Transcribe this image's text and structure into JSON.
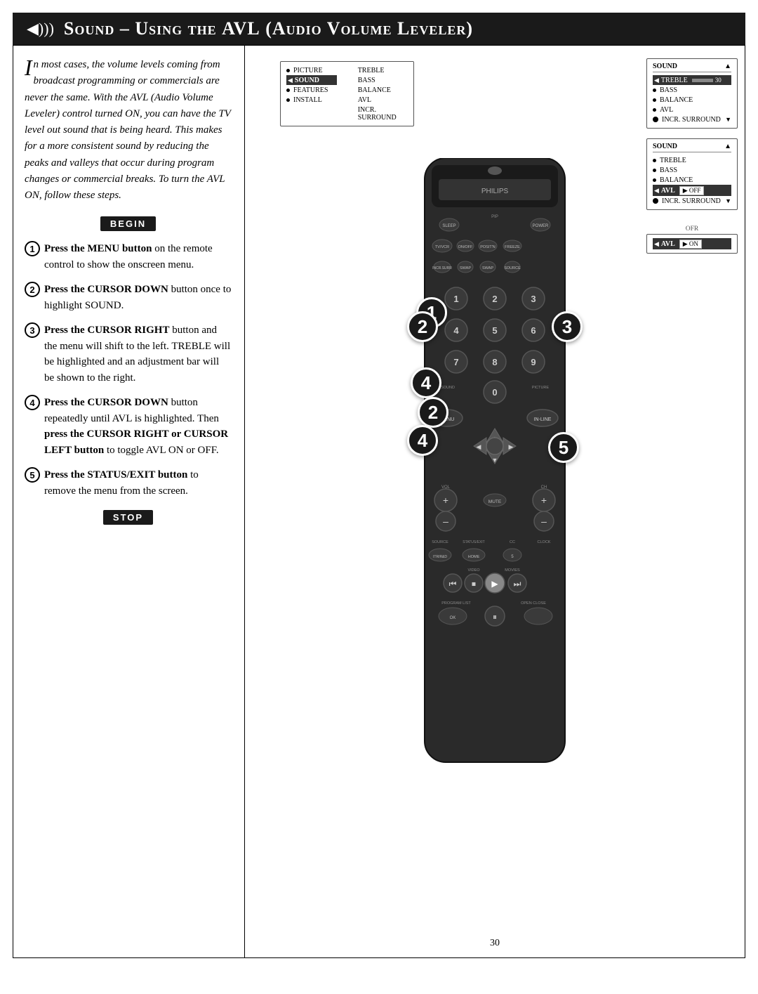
{
  "header": {
    "title": "Sound – Using the AVL (Audio Volume Leveler)",
    "icon": "◀)))"
  },
  "intro": {
    "text": "n most cases, the volume levels coming from broadcast programming or commercials are never the same.  With the AVL (Audio Volume Leveler) control turned ON, you can have the TV level out sound that is being heard.  This makes for a more consistent sound by reducing the peaks and valleys that occur during program changes or commercial breaks.  To turn the AVL ON, follow these steps."
  },
  "begin_label": "BEGIN",
  "stop_label": "STOP",
  "steps": [
    {
      "num": "1",
      "text_bold": "Press the MENU button",
      "text_rest": " on the remote control to show the onscreen menu."
    },
    {
      "num": "2",
      "text_bold": "Press the CURSOR DOWN",
      "text_rest": " button once to highlight SOUND."
    },
    {
      "num": "3",
      "text_bold": "Press the CURSOR RIGHT",
      "text_rest": " button and the menu will shift to the left. TREBLE will be highlighted and an adjustment bar will be shown to the right."
    },
    {
      "num": "4",
      "text_bold": "Press the CURSOR DOWN",
      "text_rest": " button repeatedly until AVL is highlighted.  Then press the CURSOR RIGHT or CURSOR LEFT button to toggle AVL ON or OFF."
    },
    {
      "num": "5",
      "text_bold": "Press the STATUS/EXIT but-",
      "text_rest": "ton to remove the menu from the screen."
    }
  ],
  "menu_main": {
    "items": [
      {
        "label": "PICTURE",
        "right": "TREBLE",
        "bullet": true,
        "selected": false
      },
      {
        "label": "SOUND",
        "right": "BASS",
        "bullet": false,
        "selected": true,
        "arrow": true
      },
      {
        "label": "FEATURES",
        "right": "BALANCE",
        "bullet": true,
        "selected": false
      },
      {
        "label": "INSTALL",
        "right": "AVL",
        "bullet": true,
        "selected": false
      },
      {
        "label": "",
        "right": "INCR. SURROUND",
        "bullet": false,
        "selected": false
      }
    ]
  },
  "menu_treble": {
    "title": "SOUND",
    "items": [
      {
        "label": "TREBLE",
        "bar": true,
        "val": "30",
        "selected": true,
        "arrow": true
      },
      {
        "label": "BASS",
        "bullet": true
      },
      {
        "label": "BALANCE",
        "bullet": true
      },
      {
        "label": "AVL",
        "bullet": true
      },
      {
        "label": "INCR. SURROUND",
        "bullet": false,
        "arrow_nav": true
      }
    ]
  },
  "menu_avl_off": {
    "title": "SOUND",
    "items": [
      {
        "label": "TREBLE",
        "bullet": true
      },
      {
        "label": "BASS",
        "bullet": true
      },
      {
        "label": "BALANCE",
        "bullet": true
      },
      {
        "label": "AVL",
        "selected": true,
        "arrow": true,
        "val": "OFF"
      },
      {
        "label": "INCR. SURROUND",
        "bullet": false,
        "arrow_nav": true
      }
    ]
  },
  "menu_avl_on": {
    "title": "OFR",
    "items": [
      {
        "label": "AVL",
        "val": "ON",
        "selected": true,
        "arrow": true
      }
    ]
  },
  "step_labels": [
    "1",
    "2",
    "3",
    "4",
    "5"
  ],
  "page_number": "30"
}
